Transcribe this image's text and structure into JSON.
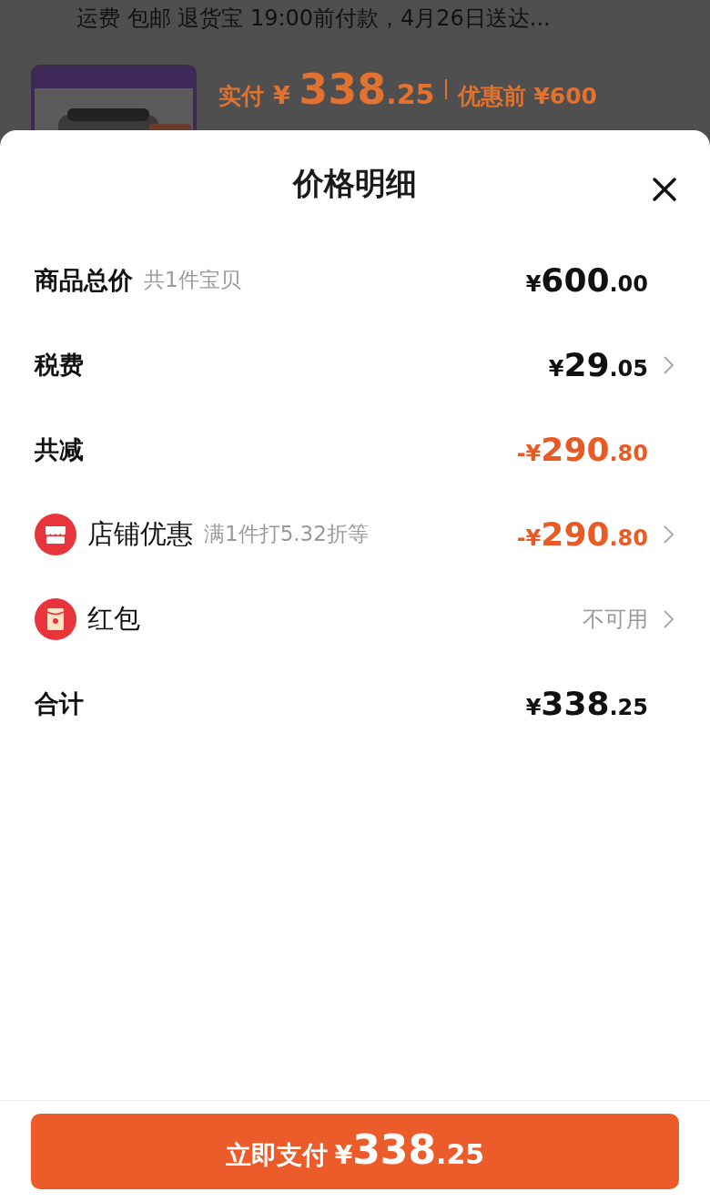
{
  "background": {
    "shipping_text": "运费 包邮 退货宝 19:00前付款，4月26日送达...",
    "paid_label": "实付",
    "paid_price": {
      "sign": "¥",
      "integer": "338",
      "decimal": ".25"
    },
    "before_label": "优惠前",
    "before_price": "¥600"
  },
  "sheet": {
    "title": "价格明细",
    "rows": [
      {
        "kind": "plain",
        "label": "商品总价",
        "note": "共1件宝贝",
        "discount": false,
        "price": {
          "sign": "¥",
          "integer": "600",
          "decimal": ".00"
        },
        "chevron": false
      },
      {
        "kind": "plain",
        "label": "税费",
        "discount": false,
        "price": {
          "sign": "¥",
          "integer": "29",
          "decimal": ".05"
        },
        "chevron": true
      },
      {
        "kind": "plain",
        "label": "共减",
        "discount": true,
        "price": {
          "sign": "-¥",
          "integer": "290",
          "decimal": ".80"
        },
        "chevron": false
      },
      {
        "kind": "store",
        "label": "店铺优惠",
        "note": "满1件打5.32折等",
        "discount": true,
        "price": {
          "sign": "-¥",
          "integer": "290",
          "decimal": ".80"
        },
        "chevron": true
      },
      {
        "kind": "redpacket",
        "label": "红包",
        "status": "不可用",
        "chevron": true
      },
      {
        "kind": "plain",
        "label": "合计",
        "discount": false,
        "price": {
          "sign": "¥",
          "integer": "338",
          "decimal": ".25"
        },
        "chevron": false
      }
    ],
    "pay_button": {
      "label": "立即支付",
      "price": {
        "sign": "¥",
        "integer": "338",
        "decimal": ".25"
      }
    }
  }
}
